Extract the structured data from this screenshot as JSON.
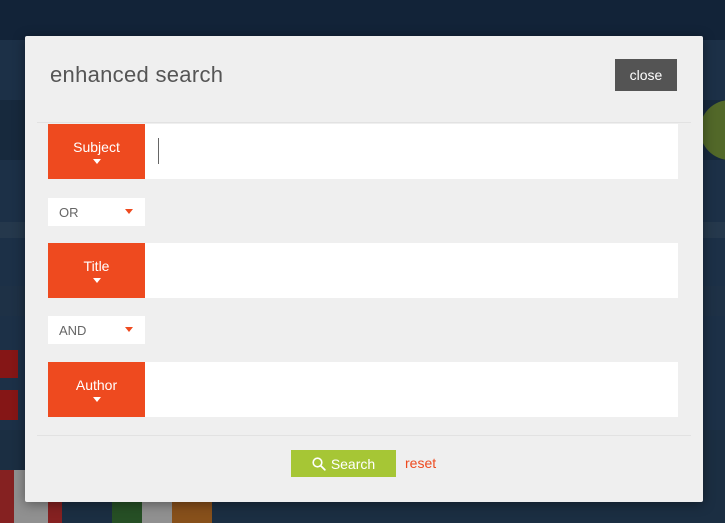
{
  "modal": {
    "title": "enhanced search",
    "close_label": "close"
  },
  "fields": [
    {
      "label": "Subject",
      "value": "",
      "placeholder": ""
    },
    {
      "label": "Title",
      "value": "",
      "placeholder": ""
    },
    {
      "label": "Author",
      "value": "",
      "placeholder": ""
    }
  ],
  "operators": [
    {
      "value": "OR"
    },
    {
      "value": "AND"
    }
  ],
  "actions": {
    "search_label": "Search",
    "reset_label": "reset",
    "search_icon": "search-icon"
  },
  "colors": {
    "accent_orange": "#ee4a1f",
    "search_green": "#a6c635",
    "close_gray": "#545454"
  }
}
